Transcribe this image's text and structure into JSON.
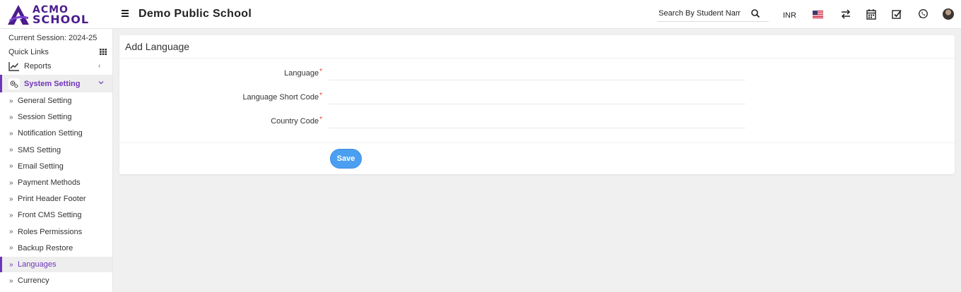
{
  "brand": {
    "logo_line1": "ACMO",
    "logo_line2": "SCHOOL",
    "color": "#4b1c8c"
  },
  "header": {
    "school_name": "Demo Public School",
    "search_placeholder": "Search By Student Name",
    "currency": "INR",
    "icons": [
      "menu-icon",
      "search-icon",
      "us-flag-icon",
      "swap-icon",
      "calendar-icon",
      "task-check-icon",
      "whatsapp-icon",
      "user-avatar"
    ]
  },
  "sidebar": {
    "session": "Current Session: 2024-25",
    "quick_links": "Quick Links",
    "reports": "Reports",
    "system_setting": "System Setting",
    "sub_items": [
      "General Setting",
      "Session Setting",
      "Notification Setting",
      "SMS Setting",
      "Email Setting",
      "Payment Methods",
      "Print Header Footer",
      "Front CMS Setting",
      "Roles Permissions",
      "Backup Restore",
      "Languages",
      "Currency"
    ],
    "active_item": "Languages",
    "accent": "#6f35b8"
  },
  "form": {
    "title": "Add Language",
    "fields": [
      {
        "label": "Language",
        "required": "*",
        "value": ""
      },
      {
        "label": "Language Short Code",
        "required": "*",
        "value": ""
      },
      {
        "label": "Country Code",
        "required": "*",
        "value": ""
      }
    ],
    "save_label": "Save",
    "save_color": "#4a9ff0"
  }
}
